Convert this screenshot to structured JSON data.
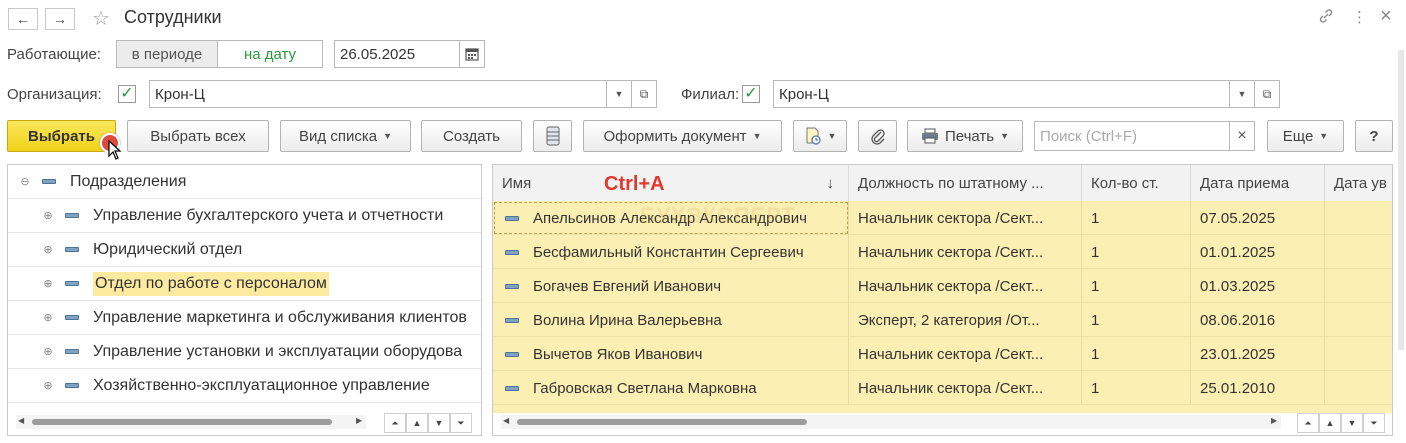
{
  "window": {
    "title": "Сотрудники",
    "back_icon": "←",
    "forward_icon": "→",
    "star_icon": "☆",
    "link_icon": "🔗",
    "more_icon": "⋮",
    "close_icon": "×"
  },
  "filter": {
    "working_label": "Работающие:",
    "in_period": "в периоде",
    "on_date": "на дату",
    "date_value": "26.05.2025",
    "org_label": "Организация:",
    "org_value": "Крон-Ц",
    "branch_label": "Филиал:",
    "branch_value": "Крон-Ц",
    "check": "✓"
  },
  "toolbar": {
    "select": "Выбрать",
    "select_all": "Выбрать всех",
    "list_view": "Вид списка",
    "create": "Создать",
    "make_document": "Оформить документ",
    "print": "Печать",
    "search_placeholder": "Поиск (Ctrl+F)",
    "more": "Еще",
    "help": "?"
  },
  "tree": {
    "root": "Подразделения",
    "items": [
      "Управление бухгалтерского учета и отчетности",
      "Юридический отдел",
      "Отдел по работе с персоналом",
      "Управление маркетинга и обслуживания клиентов",
      "Управление установки и эксплуатации оборудова",
      "Хозяйственно-эксплуатационное управление"
    ]
  },
  "table": {
    "columns": [
      "Имя",
      "Должность по штатному ...",
      "Кол-во ст.",
      "Дата приема",
      "Дата ув"
    ],
    "rows": [
      [
        "Апельсинов Александр Александрович",
        "Начальник сектора /Сект...",
        "1",
        "07.05.2025"
      ],
      [
        "Бесфамильный Константин Сергеевич",
        "Начальник сектора /Сект...",
        "1",
        "01.01.2025"
      ],
      [
        "Богачев Евгений Иванович",
        "Начальник сектора /Сект...",
        "1",
        "01.03.2025"
      ],
      [
        "Волина Ирина Валерьевна",
        "Эксперт, 2 категория /От...",
        "1",
        "08.06.2016"
      ],
      [
        "Вычетов Яков Иванович",
        "Начальник сектора /Сект...",
        "1",
        "23.01.2025"
      ],
      [
        "Габровская Светлана Марковна",
        "Начальник сектора /Сект...",
        "1",
        "25.01.2010"
      ]
    ],
    "sort_icon": "↓"
  },
  "overlay": {
    "hotkey": "Ctrl+A",
    "watermark": "БУХЭКСПЕРТ"
  },
  "colors": {
    "primary_button": "#f1d21a",
    "selected_row": "#fcefb4",
    "hotkey": "#e03a2e",
    "check": "#2a9a3c"
  }
}
